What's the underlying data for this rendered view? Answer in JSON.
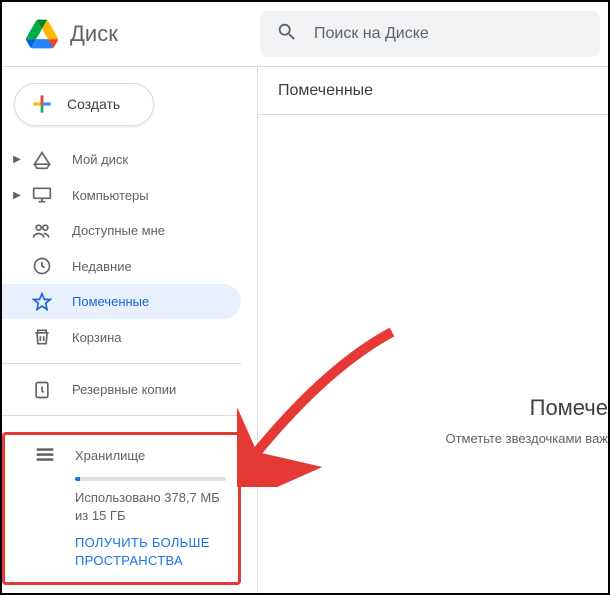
{
  "header": {
    "app_name": "Диск",
    "search_placeholder": "Поиск на Диске"
  },
  "sidebar": {
    "create_label": "Создать",
    "items": [
      {
        "label": "Мой диск",
        "icon": "my-drive",
        "has_chevron": true
      },
      {
        "label": "Компьютеры",
        "icon": "computers",
        "has_chevron": true
      },
      {
        "label": "Доступные мне",
        "icon": "shared",
        "has_chevron": false
      },
      {
        "label": "Недавние",
        "icon": "recent",
        "has_chevron": false
      },
      {
        "label": "Помеченные",
        "icon": "starred",
        "has_chevron": false,
        "active": true
      },
      {
        "label": "Корзина",
        "icon": "trash",
        "has_chevron": false
      }
    ],
    "backups_label": "Резервные копии",
    "storage": {
      "label": "Хранилище",
      "used_text": "Использовано 378,7 МБ из 15 ГБ",
      "upgrade_link": "ПОЛУЧИТЬ БОЛЬШЕ ПРОСТРАНСТВА",
      "used_bytes": "378,7 МБ",
      "total": "15 ГБ",
      "percent": 2.5
    }
  },
  "main": {
    "title": "Помеченные",
    "empty_title": "Помече",
    "empty_sub": "Отметьте звездочками важ"
  }
}
